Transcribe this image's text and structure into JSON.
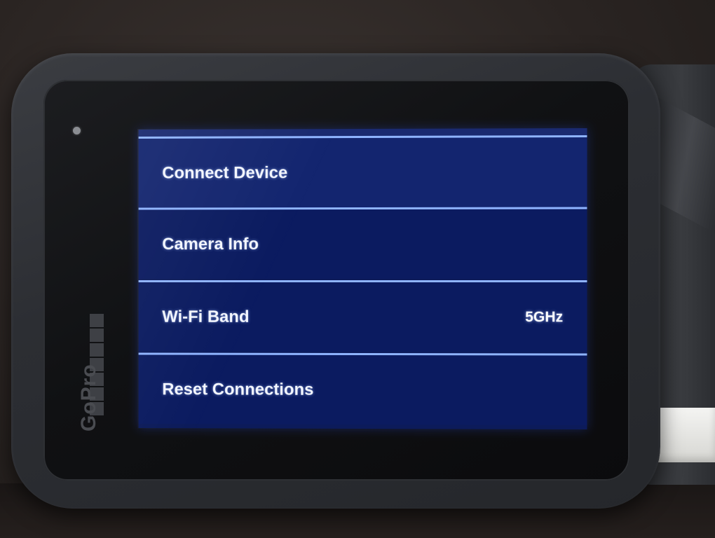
{
  "menu": {
    "items": [
      {
        "label": "Connect Device",
        "value": ""
      },
      {
        "label": "Camera Info",
        "value": ""
      },
      {
        "label": "Wi-Fi Band",
        "value": "5GHz"
      },
      {
        "label": "Reset Connections",
        "value": ""
      }
    ],
    "selected_index": 0
  },
  "branding": {
    "logo_text": "GoPro"
  },
  "colors": {
    "screen_background": "#0c1b5a",
    "row_divider": "#8fb4ff",
    "text": "#f4f7ff"
  }
}
